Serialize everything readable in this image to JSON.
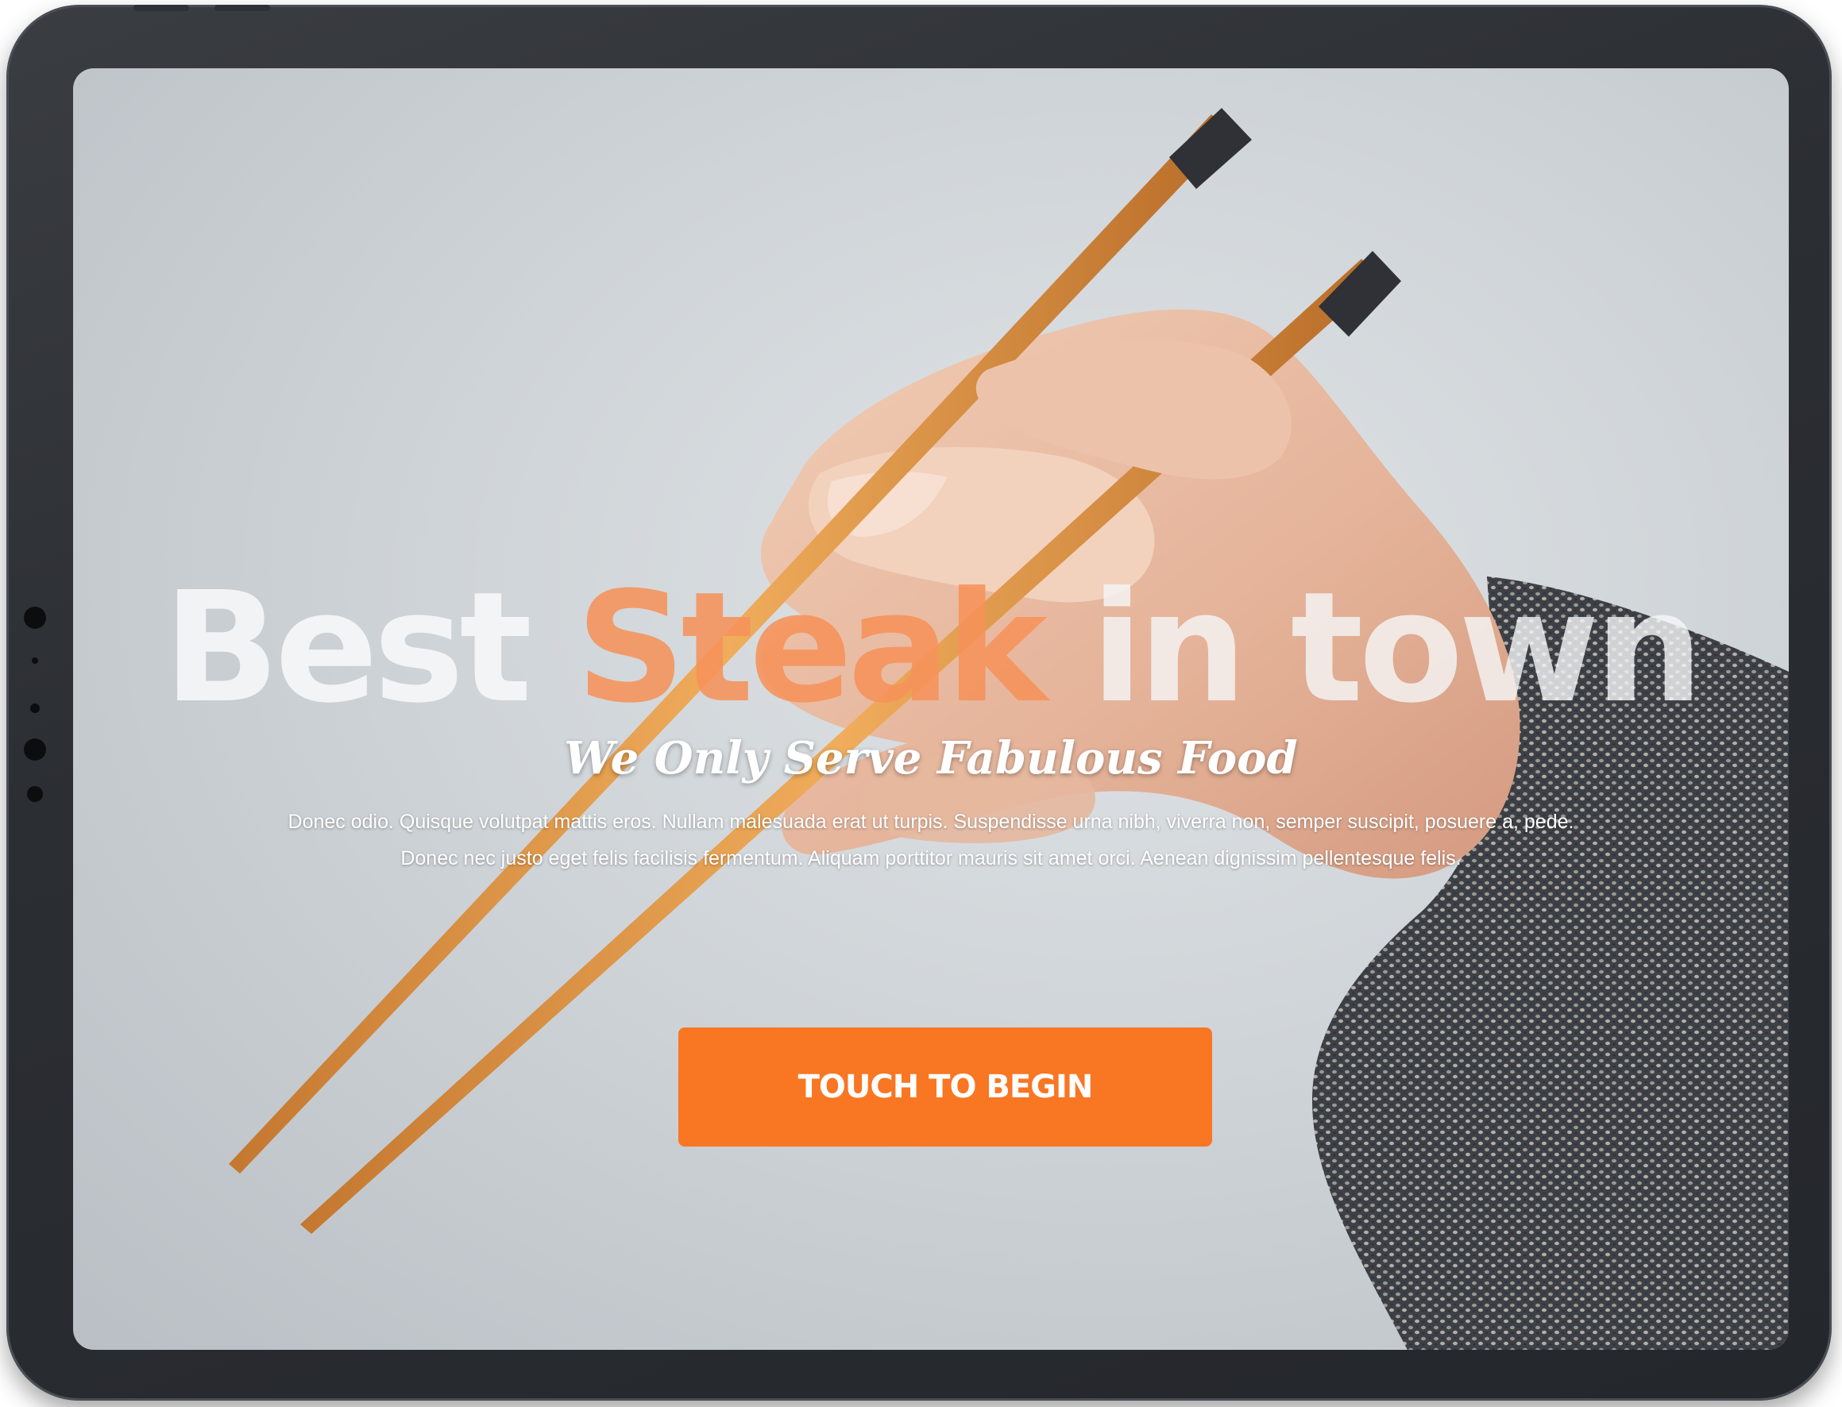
{
  "hero": {
    "headline_word_1": "Best",
    "headline_word_2": "Steak",
    "headline_word_3": "in town",
    "tagline": "We Only Serve Fabulous Food",
    "body_line_1": "Donec odio. Quisque volutpat mattis eros. Nullam malesuada erat ut turpis. Suspendisse urna nibh, viverra non, semper suscipit, posuere a, pede.",
    "body_line_2": "Donec nec justo eget felis facilisis fermentum. Aliquam porttitor mauris sit amet orci. Aenean dignissim pellentesque felis."
  },
  "cta": {
    "label": "TOUCH TO BEGIN"
  },
  "colors": {
    "accent": "#f97623",
    "headline_highlight": "#f6925a",
    "device_frame": "#2b2e33",
    "background": "#cfd4d8"
  },
  "background_image": {
    "subject": "hand holding chopsticks"
  }
}
